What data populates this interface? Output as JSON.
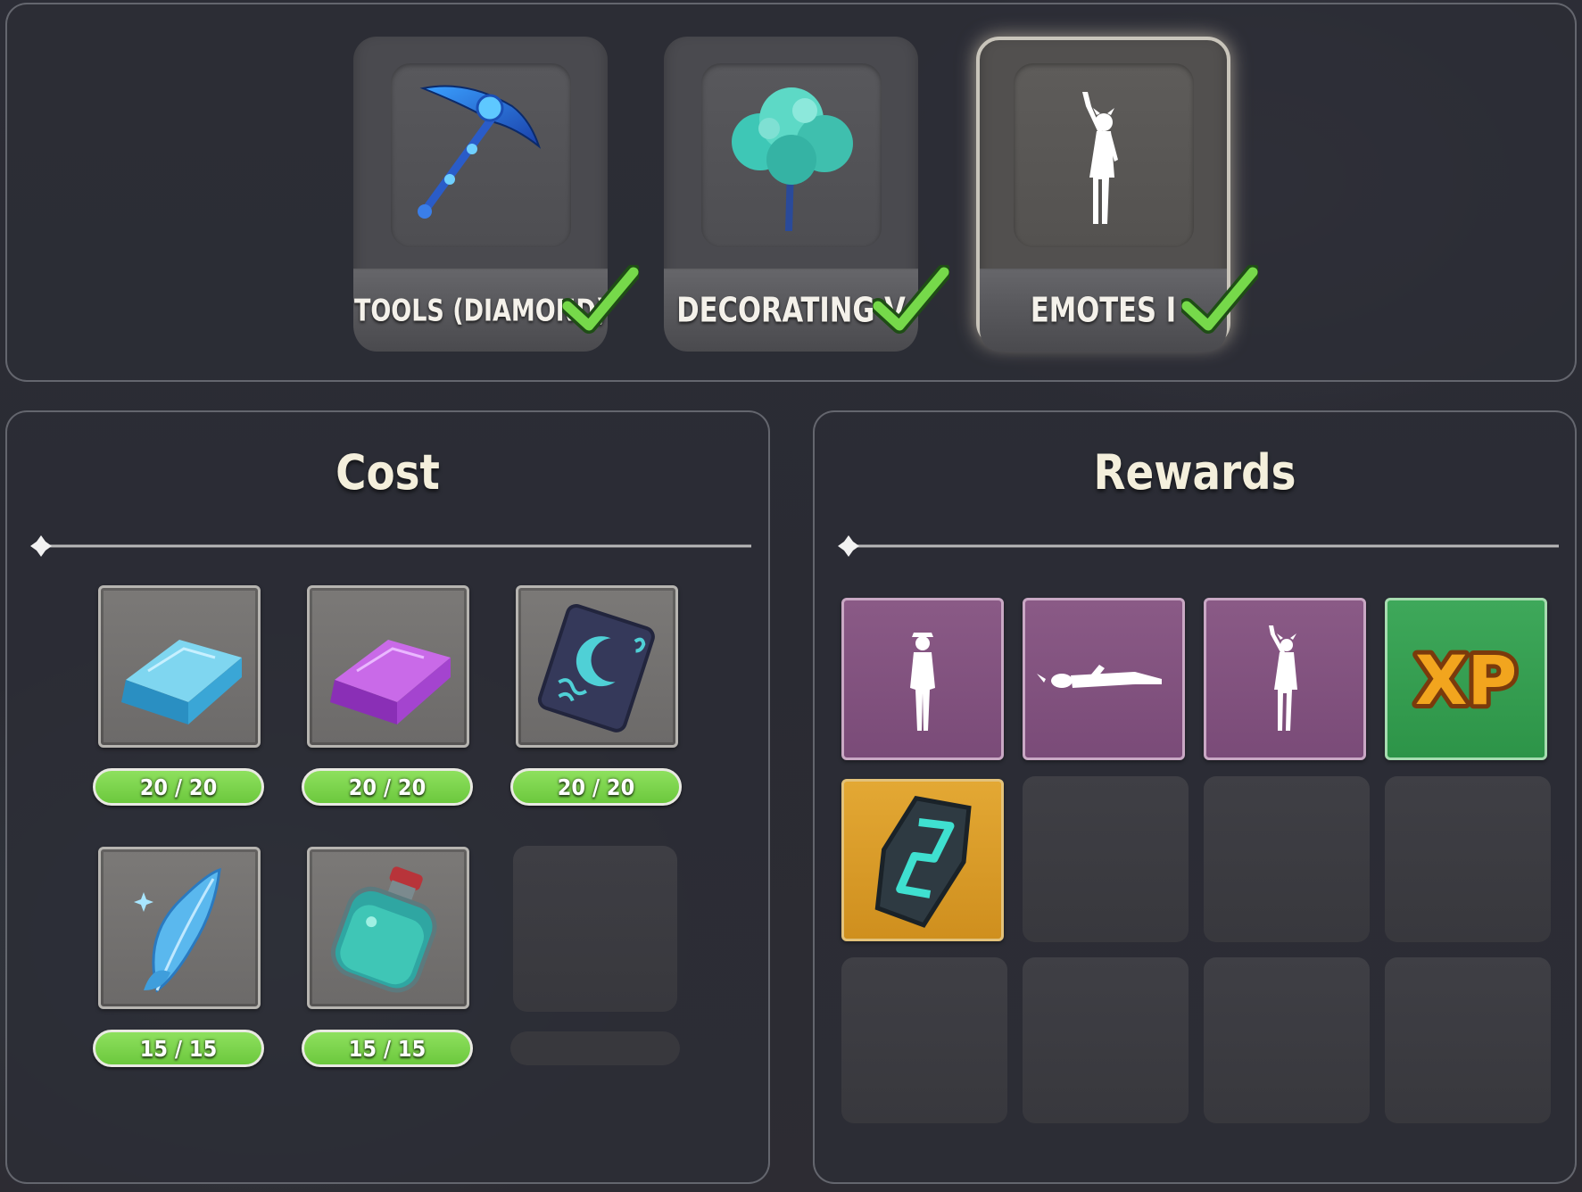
{
  "unlocks": [
    {
      "label": "TOOLS (DIAMOND)",
      "icon": "diamond-pickaxe-icon",
      "completed": true,
      "selected": false
    },
    {
      "label": "DECORATING V",
      "icon": "teal-tree-icon",
      "completed": true,
      "selected": false
    },
    {
      "label": "EMOTES I",
      "icon": "waving-figure-icon",
      "completed": true,
      "selected": true
    }
  ],
  "cost": {
    "title": "Cost",
    "items": [
      {
        "icon": "blue-ingot-icon",
        "quantity": "20 / 20"
      },
      {
        "icon": "purple-ingot-icon",
        "quantity": "20 / 20"
      },
      {
        "icon": "moon-tablet-icon",
        "quantity": "20 / 20"
      },
      {
        "icon": "fairy-wing-icon",
        "quantity": "15 / 15"
      },
      {
        "icon": "potion-bottle-icon",
        "quantity": "15 / 15"
      }
    ]
  },
  "rewards": {
    "title": "Rewards",
    "items": [
      {
        "icon": "standing-figure-emote-icon",
        "rarity": "purple"
      },
      {
        "icon": "lying-figure-emote-icon",
        "rarity": "purple"
      },
      {
        "icon": "waving-figure-emote-icon",
        "rarity": "purple"
      },
      {
        "icon": "xp-icon",
        "text": "XP",
        "rarity": "green"
      },
      {
        "icon": "rune-stone-icon",
        "rarity": "gold"
      }
    ]
  },
  "colors": {
    "complete": "#76d94a",
    "purple": "#7f4f7c",
    "green": "#34a04f",
    "gold": "#d99a27"
  }
}
